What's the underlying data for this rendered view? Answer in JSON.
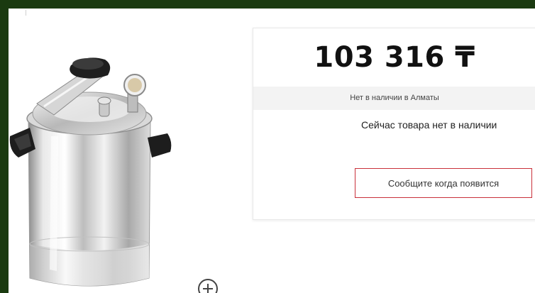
{
  "product": {
    "price": "103 316 ₸",
    "stock_location": "Нет в наличии в Алматы",
    "availability": "Сейчас товара нет в наличии",
    "notify_label": "Сообщите когда появится"
  },
  "gallery": {
    "zoom_icon": "zoom-in-icon"
  },
  "colors": {
    "frame_background": "#1a3a10",
    "notify_border": "#c9303a",
    "stock_bar": "#f3f3f3"
  }
}
